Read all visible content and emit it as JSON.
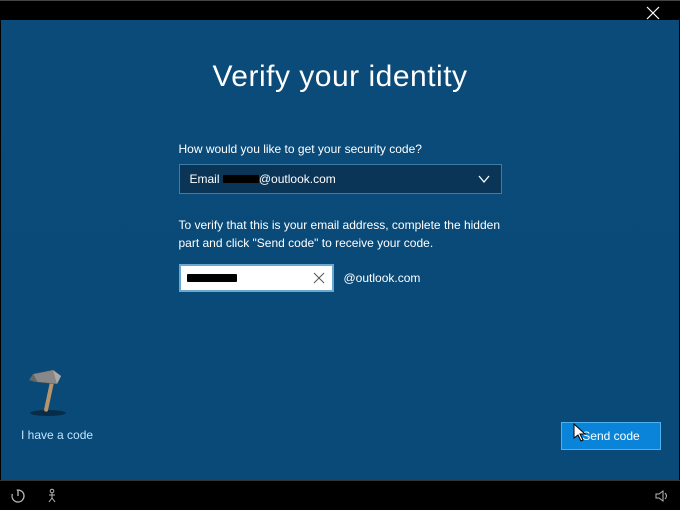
{
  "title": "Verify your identity",
  "prompt_label": "How would you like to get your security code?",
  "select": {
    "prefix": "Email",
    "masked": "••••••",
    "domain": "@outlook.com"
  },
  "instruction": "To verify that this is your email address, complete the hidden part and click \"Send code\" to receive your code.",
  "input": {
    "value": "••••••",
    "suffix": "@outlook.com"
  },
  "have_code_link": "I have a code",
  "send_button": "Send code"
}
